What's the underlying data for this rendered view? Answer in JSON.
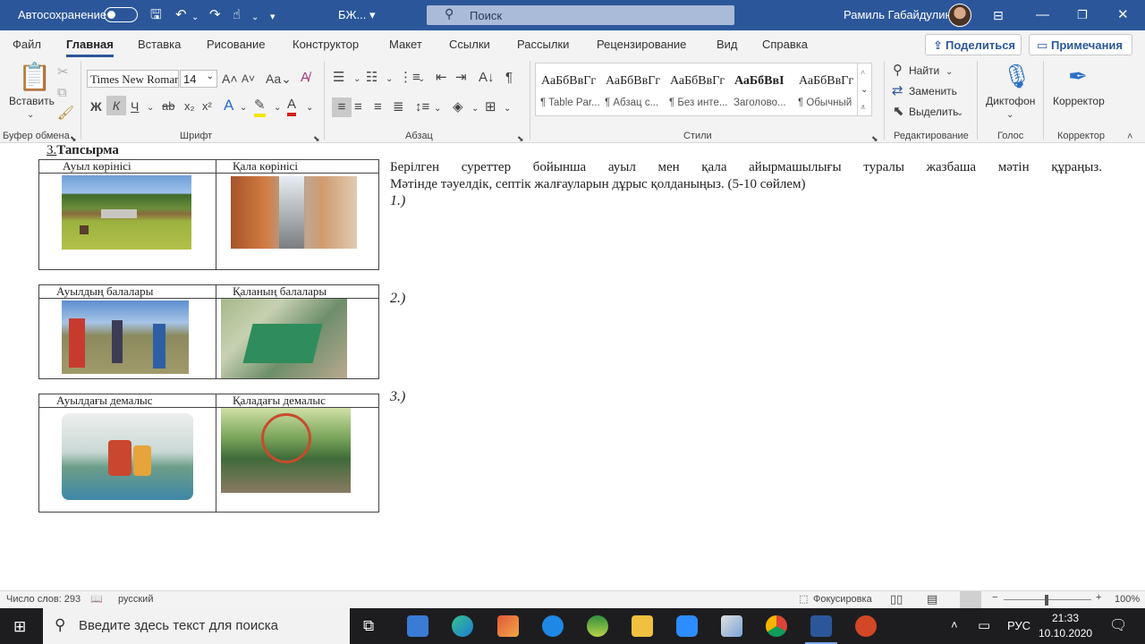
{
  "titlebar": {
    "autosave_label": "Автосохранение",
    "doc_name": "БЖ...",
    "search_placeholder": "Поиск",
    "user_name": "Рамиль Габайдулин"
  },
  "menu": {
    "tabs": [
      "Файл",
      "Главная",
      "Вставка",
      "Рисование",
      "Конструктор",
      "Макет",
      "Ссылки",
      "Рассылки",
      "Рецензирование",
      "Вид",
      "Справка"
    ],
    "share_label": "Поделиться",
    "notes_label": "Примечания"
  },
  "ribbon": {
    "paste_label": "Вставить",
    "font_name": "Times New Roman",
    "font_size": "14",
    "styles": [
      {
        "sample": "АаБбВвГг",
        "name": "¶ Table Par..."
      },
      {
        "sample": "АаБбВвГг",
        "name": "¶ Абзац с..."
      },
      {
        "sample": "АаБбВвГг",
        "name": "¶ Без инте..."
      },
      {
        "sample": "АаБбВвI",
        "name": "Заголово..."
      },
      {
        "sample": "АаБбВвГг",
        "name": "¶ Обычный"
      }
    ],
    "find_label": "Найти",
    "replace_label": "Заменить",
    "select_label": "Выделить",
    "dictate_label": "Диктофон",
    "editor_label": "Корректор",
    "groups": {
      "clipboard": "Буфер обмена",
      "font": "Шрифт",
      "paragraph": "Абзац",
      "styles": "Стили",
      "editing": "Редактирование",
      "voice": "Голос",
      "editor": "Корректор"
    }
  },
  "document": {
    "heading_num": "3.",
    "heading_title": "Тапсырма",
    "table1": {
      "left": "Ауыл көрінісі",
      "right": "Қала көрінісі"
    },
    "table2": {
      "left": "Ауылдың балалары",
      "right": "Қаланың балалары"
    },
    "table3": {
      "left": "Ауылдағы  демалыс",
      "right": "Қаладағы демалыс"
    },
    "task_line1": "Берілген суреттер бойынша ауыл мен қала айырмашылығы туралы жазбаша мәтін құраңыз.",
    "task_line2": "Мәтінде тәуелдік, септік жалғауларын дұрыс қолданыңыз. (5-10 сөйлем)",
    "item1": "1.)",
    "item2": "2.)",
    "item3": "3.)"
  },
  "statusbar": {
    "word_count": "Число слов: 293",
    "language": "русский",
    "focus": "Фокусировка",
    "zoom": "100%"
  },
  "taskbar": {
    "search_placeholder": "Введите здесь текст для поиска",
    "lang": "РУС",
    "time": "21:33",
    "date": "10.10.2020"
  }
}
